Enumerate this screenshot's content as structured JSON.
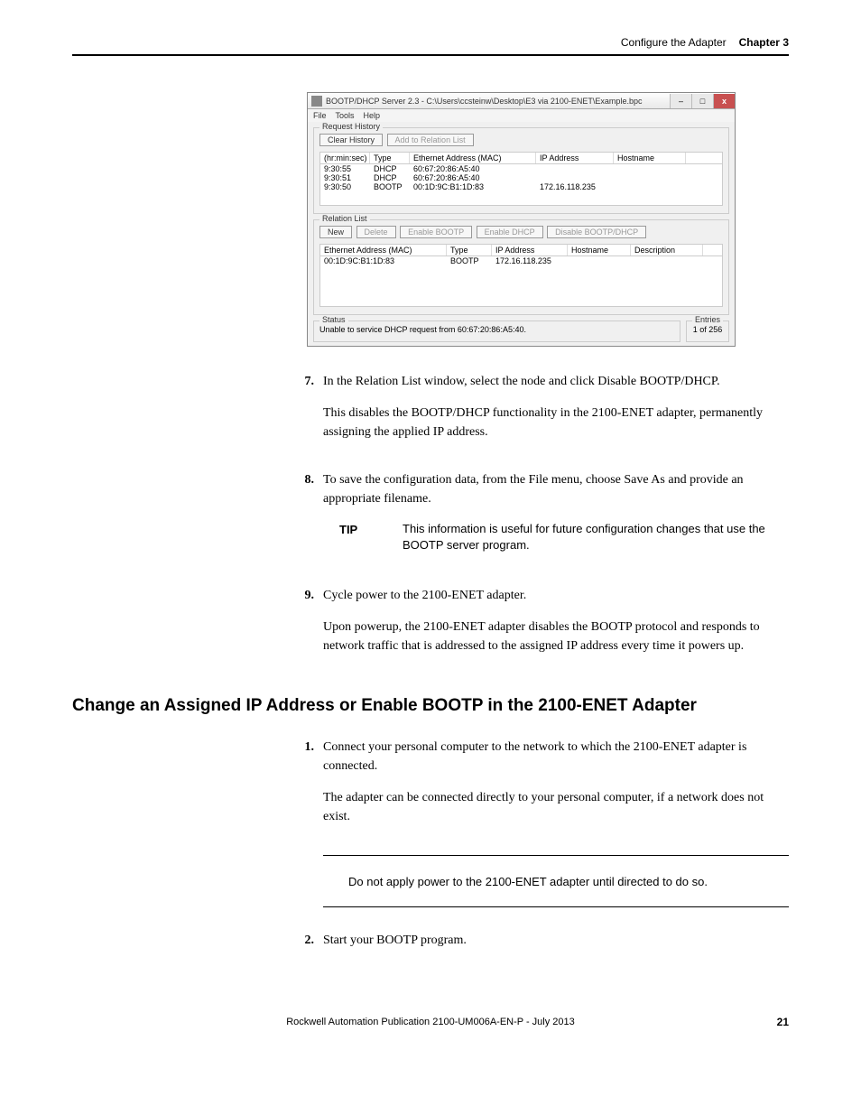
{
  "header": {
    "section": "Configure the Adapter",
    "chapter": "Chapter 3"
  },
  "screenshot": {
    "title": "BOOTP/DHCP Server 2.3 - C:\\Users\\ccsteinw\\Desktop\\E3 via 2100-ENET\\Example.bpc",
    "menu": {
      "file": "File",
      "tools": "Tools",
      "help": "Help"
    },
    "request_history": {
      "label": "Request History",
      "clear_btn": "Clear History",
      "add_btn": "Add to Relation List",
      "columns": {
        "time": "(hr:min:sec)",
        "type": "Type",
        "mac": "Ethernet Address (MAC)",
        "ip": "IP Address",
        "host": "Hostname"
      },
      "rows": [
        {
          "time": "9:30:55",
          "type": "DHCP",
          "mac": "60:67:20:86:A5:40",
          "ip": "",
          "host": ""
        },
        {
          "time": "9:30:51",
          "type": "DHCP",
          "mac": "60:67:20:86:A5:40",
          "ip": "",
          "host": ""
        },
        {
          "time": "9:30:50",
          "type": "BOOTP",
          "mac": "00:1D:9C:B1:1D:83",
          "ip": "172.16.118.235",
          "host": ""
        }
      ]
    },
    "relation_list": {
      "label": "Relation List",
      "new_btn": "New",
      "delete_btn": "Delete",
      "enable_bootp_btn": "Enable BOOTP",
      "enable_dhcp_btn": "Enable DHCP",
      "disable_btn": "Disable BOOTP/DHCP",
      "columns": {
        "mac": "Ethernet Address (MAC)",
        "type": "Type",
        "ip": "IP Address",
        "host": "Hostname",
        "desc": "Description"
      },
      "rows": [
        {
          "mac": "00:1D:9C:B1:1D:83",
          "type": "BOOTP",
          "ip": "172.16.118.235",
          "host": "",
          "desc": ""
        }
      ]
    },
    "status": {
      "label": "Status",
      "text": "Unable to service DHCP request from 60:67:20:86:A5:40."
    },
    "entries": {
      "label": "Entries",
      "text": "1 of 256"
    }
  },
  "steps": {
    "s7": {
      "num": "7.",
      "p1": "In the Relation List window, select the node and click Disable BOOTP/DHCP.",
      "p2": "This disables the BOOTP/DHCP functionality in the 2100-ENET adapter, permanently assigning the applied IP address."
    },
    "s8": {
      "num": "8.",
      "p1": "To save the configuration data, from the File menu, choose Save As and provide an appropriate filename."
    },
    "tip": {
      "label": "TIP",
      "text": "This information is useful for future configuration changes that use the BOOTP server program."
    },
    "s9": {
      "num": "9.",
      "p1": "Cycle power to the 2100-ENET adapter.",
      "p2": "Upon powerup, the 2100-ENET adapter disables the BOOTP protocol and responds to network traffic that is addressed to the assigned IP address every time it powers up."
    }
  },
  "heading": "Change an Assigned IP Address or Enable BOOTP in the 2100-ENET Adapter",
  "steps2": {
    "s1": {
      "num": "1.",
      "p1": "Connect your personal computer to the network to which the 2100-ENET adapter is connected.",
      "p2": "The adapter can be connected directly to your personal computer, if a network does not exist."
    },
    "s2": {
      "num": "2.",
      "p1": "Start your BOOTP program."
    }
  },
  "warning": "Do not apply power to the 2100-ENET adapter until directed to do so.",
  "footer": {
    "pub": "Rockwell Automation Publication 2100-UM006A-EN-P - July 2013",
    "page": "21"
  }
}
